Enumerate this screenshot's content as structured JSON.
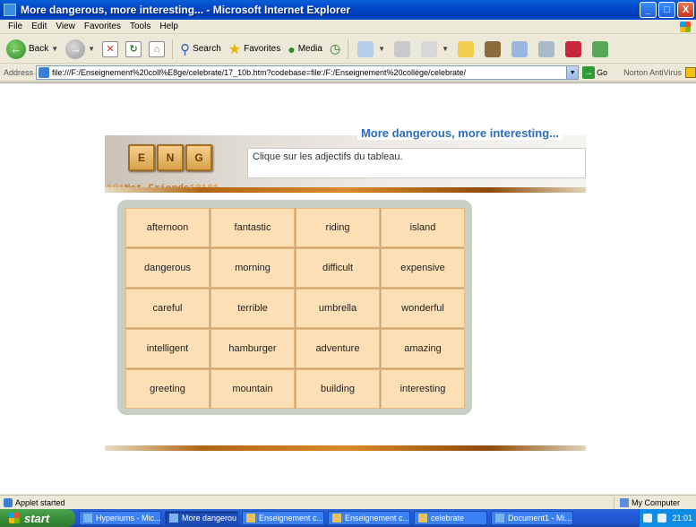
{
  "window": {
    "title": "More dangerous, more interesting... - Microsoft Internet Explorer",
    "minimize": "_",
    "maximize": "□",
    "close": "X"
  },
  "menu": [
    "File",
    "Edit",
    "View",
    "Favorites",
    "Tools",
    "Help"
  ],
  "toolbar": {
    "back_label": "Back",
    "search_label": "Search",
    "favorites_label": "Favorites",
    "media_label": "Media"
  },
  "address": {
    "label": "Address",
    "url": "file:///F:/Enseignement%20coll%E8ge/celebrate/17_10b.htm?codebase=file:/F:/Enseignement%20collège/celebrate/",
    "go_label": "Go",
    "norton_label": "Norton AntiVirus"
  },
  "page": {
    "title": "More dangerous, more interesting...",
    "tiles": [
      "E",
      "N",
      "G"
    ],
    "brand": "Net Friends",
    "brand_prefix": "101",
    "brand_suffix": "10101",
    "instruction": "Clique sur les adjectifs du tableau.",
    "words": [
      "afternoon",
      "fantastic",
      "riding",
      "island",
      "dangerous",
      "morning",
      "difficult",
      "expensive",
      "careful",
      "terrible",
      "umbrella",
      "wonderful",
      "intelligent",
      "hamburger",
      "adventure",
      "amazing",
      "greeting",
      "mountain",
      "building",
      "interesting"
    ]
  },
  "status": {
    "text": "Applet started",
    "zone": "My Computer"
  },
  "taskbar": {
    "start": "start",
    "tasks": [
      {
        "label": "Hyperiums - Mic...",
        "active": false
      },
      {
        "label": "More dangerou...",
        "active": true
      },
      {
        "label": "Enseignement c...",
        "active": false
      },
      {
        "label": "Enseignement c...",
        "active": false
      },
      {
        "label": "celebrate",
        "active": false
      },
      {
        "label": "Document1 - Mi...",
        "active": false
      }
    ],
    "clock": "21:01"
  },
  "colors": {
    "title_blue": "#2c6cc0",
    "cell_bg": "#fddfb6",
    "panel_bg": "#c8d0c3"
  }
}
